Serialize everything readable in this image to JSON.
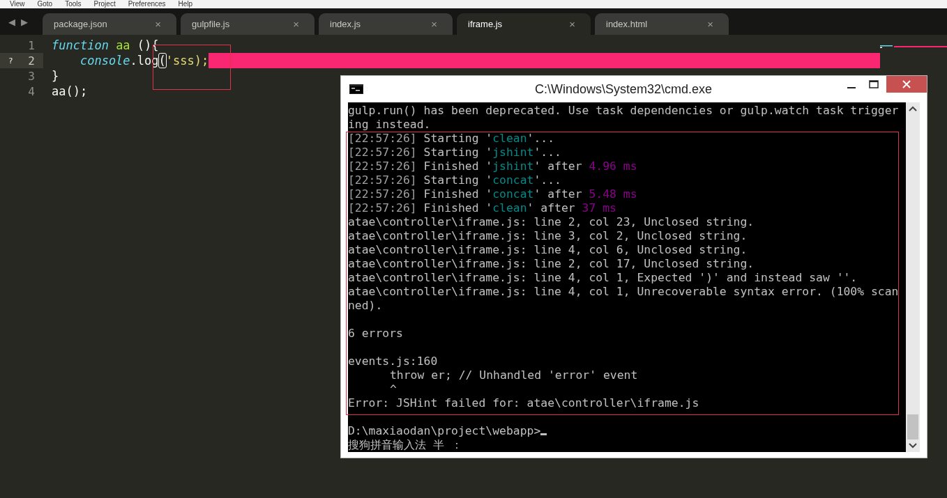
{
  "menu": [
    "View",
    "Goto",
    "Tools",
    "Project",
    "Preferences",
    "Help"
  ],
  "nav": {
    "back": "◀",
    "forward": "▶"
  },
  "tabs": [
    {
      "label": "package.json",
      "close": "×",
      "selected": false
    },
    {
      "label": "gulpfile.js",
      "close": "×",
      "selected": false
    },
    {
      "label": "index.js",
      "close": "×",
      "selected": false
    },
    {
      "label": "iframe.js",
      "close": "×",
      "selected": true
    },
    {
      "label": "index.html",
      "close": "×",
      "selected": false
    }
  ],
  "editor": {
    "lines": [
      {
        "number": "1",
        "current": false,
        "tokens": [
          {
            "kind": "keyword",
            "text": "function"
          },
          {
            "kind": "name",
            "text": " aa"
          },
          {
            "kind": "plain",
            "text": " (){"
          }
        ]
      },
      {
        "number": "2",
        "current": true,
        "marker": "?",
        "tokens": [
          {
            "kind": "keyword",
            "text": "    console"
          },
          {
            "kind": "plain",
            "text": ".log"
          },
          {
            "kind": "bracket",
            "text": "("
          },
          {
            "kind": "string",
            "text": "'sss);"
          }
        ]
      },
      {
        "number": "3",
        "current": false,
        "tokens": [
          {
            "kind": "plain",
            "text": "}"
          }
        ]
      },
      {
        "number": "4",
        "current": false,
        "tokens": [
          {
            "kind": "plain",
            "text": "aa();"
          }
        ]
      }
    ]
  },
  "console": {
    "title": "C:\\Windows\\System32\\cmd.exe",
    "lines": [
      {
        "kind": "text",
        "segments": [
          {
            "kind": "plain",
            "text": "gulp.run() has been deprecated. Use task dependencies or gulp.watch task trigger"
          }
        ]
      },
      {
        "kind": "text",
        "segments": [
          {
            "kind": "plain",
            "text": "ing instead."
          }
        ]
      },
      {
        "kind": "text",
        "segments": [
          {
            "kind": "time",
            "text": "[22:57:26]"
          },
          {
            "kind": "plain",
            "text": " Starting '"
          },
          {
            "kind": "task",
            "text": "clean"
          },
          {
            "kind": "plain",
            "text": "'..."
          }
        ]
      },
      {
        "kind": "text",
        "segments": [
          {
            "kind": "time",
            "text": "[22:57:26]"
          },
          {
            "kind": "plain",
            "text": " Starting '"
          },
          {
            "kind": "task",
            "text": "jshint"
          },
          {
            "kind": "plain",
            "text": "'..."
          }
        ]
      },
      {
        "kind": "text",
        "segments": [
          {
            "kind": "time",
            "text": "[22:57:26]"
          },
          {
            "kind": "plain",
            "text": " Finished '"
          },
          {
            "kind": "task",
            "text": "jshint"
          },
          {
            "kind": "plain",
            "text": "' after "
          },
          {
            "kind": "duration",
            "text": "4.96 ms"
          }
        ]
      },
      {
        "kind": "text",
        "segments": [
          {
            "kind": "time",
            "text": "[22:57:26]"
          },
          {
            "kind": "plain",
            "text": " Starting '"
          },
          {
            "kind": "task",
            "text": "concat"
          },
          {
            "kind": "plain",
            "text": "'..."
          }
        ]
      },
      {
        "kind": "text",
        "segments": [
          {
            "kind": "time",
            "text": "[22:57:26]"
          },
          {
            "kind": "plain",
            "text": " Finished '"
          },
          {
            "kind": "task",
            "text": "concat"
          },
          {
            "kind": "plain",
            "text": "' after "
          },
          {
            "kind": "duration",
            "text": "5.48 ms"
          }
        ]
      },
      {
        "kind": "text",
        "segments": [
          {
            "kind": "time",
            "text": "[22:57:26]"
          },
          {
            "kind": "plain",
            "text": " Finished '"
          },
          {
            "kind": "task",
            "text": "clean"
          },
          {
            "kind": "plain",
            "text": "' after "
          },
          {
            "kind": "duration",
            "text": "37 ms"
          }
        ]
      },
      {
        "kind": "text",
        "segments": [
          {
            "kind": "plain",
            "text": "atae\\controller\\iframe.js: line 2, col 23, Unclosed string."
          }
        ]
      },
      {
        "kind": "text",
        "segments": [
          {
            "kind": "plain",
            "text": "atae\\controller\\iframe.js: line 3, col 2, Unclosed string."
          }
        ]
      },
      {
        "kind": "text",
        "segments": [
          {
            "kind": "plain",
            "text": "atae\\controller\\iframe.js: line 4, col 6, Unclosed string."
          }
        ]
      },
      {
        "kind": "text",
        "segments": [
          {
            "kind": "plain",
            "text": "atae\\controller\\iframe.js: line 2, col 17, Unclosed string."
          }
        ]
      },
      {
        "kind": "text",
        "segments": [
          {
            "kind": "plain",
            "text": "atae\\controller\\iframe.js: line 4, col 1, Expected ')' and instead saw ''."
          }
        ]
      },
      {
        "kind": "text",
        "segments": [
          {
            "kind": "plain",
            "text": "atae\\controller\\iframe.js: line 4, col 1, Unrecoverable syntax error. (100% scan"
          }
        ]
      },
      {
        "kind": "text",
        "segments": [
          {
            "kind": "plain",
            "text": "ned)."
          }
        ]
      },
      {
        "kind": "blank"
      },
      {
        "kind": "text",
        "segments": [
          {
            "kind": "plain",
            "text": "6 errors"
          }
        ]
      },
      {
        "kind": "blank"
      },
      {
        "kind": "text",
        "segments": [
          {
            "kind": "plain",
            "text": "events.js:160"
          }
        ]
      },
      {
        "kind": "indented",
        "segments": [
          {
            "kind": "plain",
            "text": "throw er; // Unhandled 'error' event"
          }
        ]
      },
      {
        "kind": "indented",
        "segments": [
          {
            "kind": "plain",
            "text": "^"
          }
        ]
      },
      {
        "kind": "text",
        "segments": [
          {
            "kind": "plain",
            "text": "Error: JSHint failed for: atae\\controller\\iframe.js"
          }
        ]
      },
      {
        "kind": "blank"
      },
      {
        "kind": "prompt",
        "segments": [
          {
            "kind": "plain",
            "text": "D:\\maxiaodan\\project\\webapp>"
          }
        ]
      },
      {
        "kind": "text",
        "segments": [
          {
            "kind": "plain",
            "text": "搜狗拼音输入法 半 ："
          }
        ]
      }
    ]
  }
}
